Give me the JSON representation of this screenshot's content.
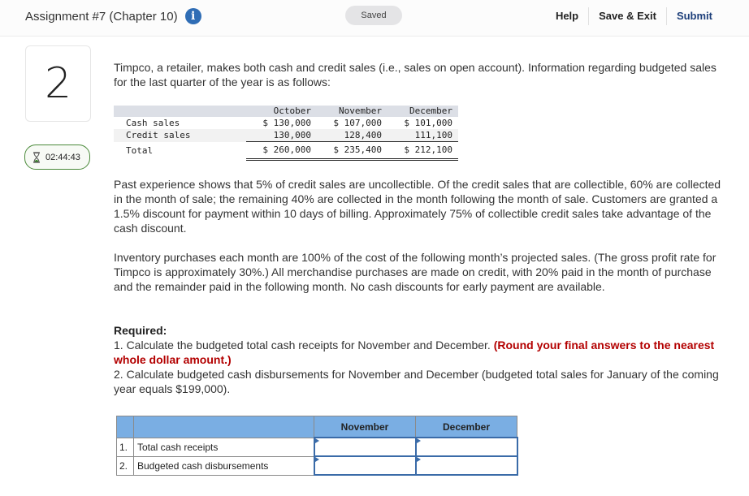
{
  "header": {
    "assignment_title": "Assignment #7 (Chapter 10)",
    "info_icon": "info-icon",
    "status": "Saved",
    "nav": {
      "help": "Help",
      "save_exit": "Save & Exit",
      "submit": "Submit"
    }
  },
  "sidebar": {
    "question_number": "2",
    "timer": "02:44:43",
    "timer_icon": "hourglass-icon"
  },
  "question": {
    "intro": "Timpco, a retailer, makes both cash and credit sales (i.e., sales on open account). Information regarding budgeted sales for the last quarter of the year is as follows:",
    "sales_table": {
      "columns": [
        "October",
        "November",
        "December"
      ],
      "rows": [
        {
          "label": "Cash sales",
          "values": [
            "$ 130,000",
            "$ 107,000",
            "$ 101,000"
          ]
        },
        {
          "label": "Credit sales",
          "values": [
            "130,000",
            "128,400",
            "111,100"
          ]
        },
        {
          "label": "Total",
          "values": [
            "$ 260,000",
            "$ 235,400",
            "$ 212,100"
          ]
        }
      ]
    },
    "paragraph1": "Past experience shows that 5% of credit sales are uncollectible. Of the credit sales that are collectible, 60% are collected in the month of sale; the remaining 40% are collected in the month following the month of sale. Customers are granted a 1.5% discount for payment within 10 days of billing. Approximately 75% of collectible credit sales take advantage of the cash discount.",
    "paragraph2": "Inventory purchases each month are 100% of the cost of the following month’s projected sales. (The gross profit rate for Timpco is approximately 30%.) All merchandise purchases are made on credit, with 20% paid in the month of purchase and the remainder paid in the following month. No cash discounts for early payment are available.",
    "required_heading": "Required:",
    "req1_text": "1. Calculate the budgeted total cash receipts for November and December. ",
    "req1_note": "(Round your final answers to the nearest whole dollar amount.)",
    "req2_text": "2. Calculate budgeted cash disbursements for November and December (budgeted total sales for January of the coming year equals $199,000)."
  },
  "answer_table": {
    "columns": [
      "",
      "",
      "November",
      "December"
    ],
    "rows": [
      {
        "num": "1.",
        "label": "Total cash receipts",
        "november": "",
        "december": ""
      },
      {
        "num": "2.",
        "label": "Budgeted cash disbursements",
        "november": "",
        "december": ""
      }
    ]
  }
}
